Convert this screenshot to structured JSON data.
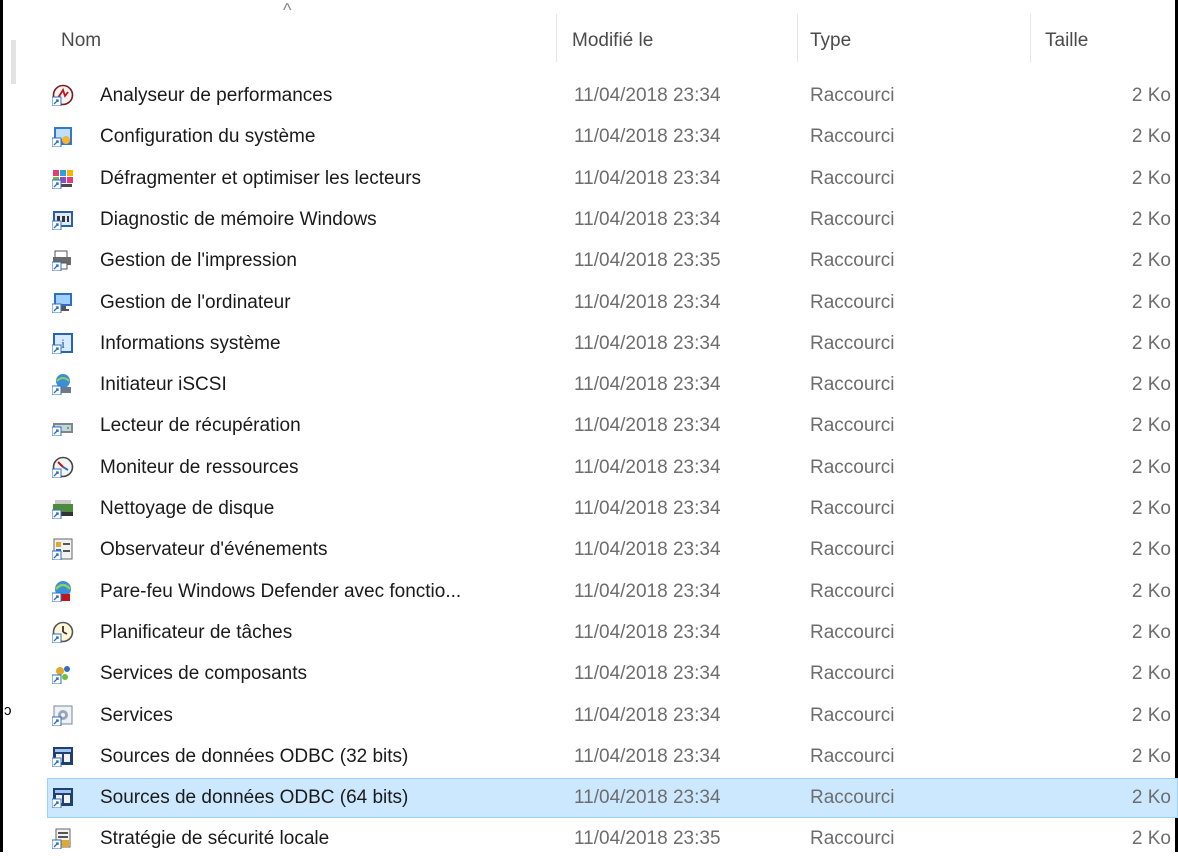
{
  "header": {
    "name": "Nom",
    "modified": "Modifié le",
    "type": "Type",
    "size": "Taille",
    "sort_indicator": "^"
  },
  "side_glyph": "ↄ",
  "rows": [
    {
      "name": "Analyseur de performances",
      "modified": "11/04/2018 23:34",
      "type": "Raccourci",
      "size": "2 Ko",
      "icon": "performance-monitor-icon"
    },
    {
      "name": "Configuration du système",
      "modified": "11/04/2018 23:34",
      "type": "Raccourci",
      "size": "2 Ko",
      "icon": "system-configuration-icon"
    },
    {
      "name": "Défragmenter et optimiser les lecteurs",
      "modified": "11/04/2018 23:34",
      "type": "Raccourci",
      "size": "2 Ko",
      "icon": "defragment-icon"
    },
    {
      "name": "Diagnostic de mémoire Windows",
      "modified": "11/04/2018 23:34",
      "type": "Raccourci",
      "size": "2 Ko",
      "icon": "memory-diagnostic-icon"
    },
    {
      "name": "Gestion de l'impression",
      "modified": "11/04/2018 23:35",
      "type": "Raccourci",
      "size": "2 Ko",
      "icon": "print-management-icon"
    },
    {
      "name": "Gestion de l'ordinateur",
      "modified": "11/04/2018 23:34",
      "type": "Raccourci",
      "size": "2 Ko",
      "icon": "computer-management-icon"
    },
    {
      "name": "Informations système",
      "modified": "11/04/2018 23:34",
      "type": "Raccourci",
      "size": "2 Ko",
      "icon": "system-information-icon"
    },
    {
      "name": "Initiateur iSCSI",
      "modified": "11/04/2018 23:34",
      "type": "Raccourci",
      "size": "2 Ko",
      "icon": "iscsi-initiator-icon"
    },
    {
      "name": "Lecteur de récupération",
      "modified": "11/04/2018 23:34",
      "type": "Raccourci",
      "size": "2 Ko",
      "icon": "recovery-drive-icon"
    },
    {
      "name": "Moniteur de ressources",
      "modified": "11/04/2018 23:34",
      "type": "Raccourci",
      "size": "2 Ko",
      "icon": "resource-monitor-icon"
    },
    {
      "name": "Nettoyage de disque",
      "modified": "11/04/2018 23:34",
      "type": "Raccourci",
      "size": "2 Ko",
      "icon": "disk-cleanup-icon"
    },
    {
      "name": "Observateur d'événements",
      "modified": "11/04/2018 23:34",
      "type": "Raccourci",
      "size": "2 Ko",
      "icon": "event-viewer-icon"
    },
    {
      "name": "Pare-feu Windows Defender avec fonctio...",
      "modified": "11/04/2018 23:34",
      "type": "Raccourci",
      "size": "2 Ko",
      "icon": "firewall-icon"
    },
    {
      "name": "Planificateur de tâches",
      "modified": "11/04/2018 23:34",
      "type": "Raccourci",
      "size": "2 Ko",
      "icon": "task-scheduler-icon"
    },
    {
      "name": "Services de composants",
      "modified": "11/04/2018 23:34",
      "type": "Raccourci",
      "size": "2 Ko",
      "icon": "component-services-icon"
    },
    {
      "name": "Services",
      "modified": "11/04/2018 23:34",
      "type": "Raccourci",
      "size": "2 Ko",
      "icon": "services-icon"
    },
    {
      "name": "Sources de données ODBC (32 bits)",
      "modified": "11/04/2018 23:34",
      "type": "Raccourci",
      "size": "2 Ko",
      "icon": "odbc-icon"
    },
    {
      "name": "Sources de données ODBC (64 bits)",
      "modified": "11/04/2018 23:34",
      "type": "Raccourci",
      "size": "2 Ko",
      "icon": "odbc-icon",
      "selected": true
    },
    {
      "name": "Stratégie de sécurité locale",
      "modified": "11/04/2018 23:35",
      "type": "Raccourci",
      "size": "2 Ko",
      "icon": "local-security-policy-icon"
    }
  ],
  "colors": {
    "selection_bg": "#cce8ff",
    "selection_border": "#99d1ff",
    "header_text": "#4b4b4b",
    "detail_text": "#6d6d6d"
  }
}
